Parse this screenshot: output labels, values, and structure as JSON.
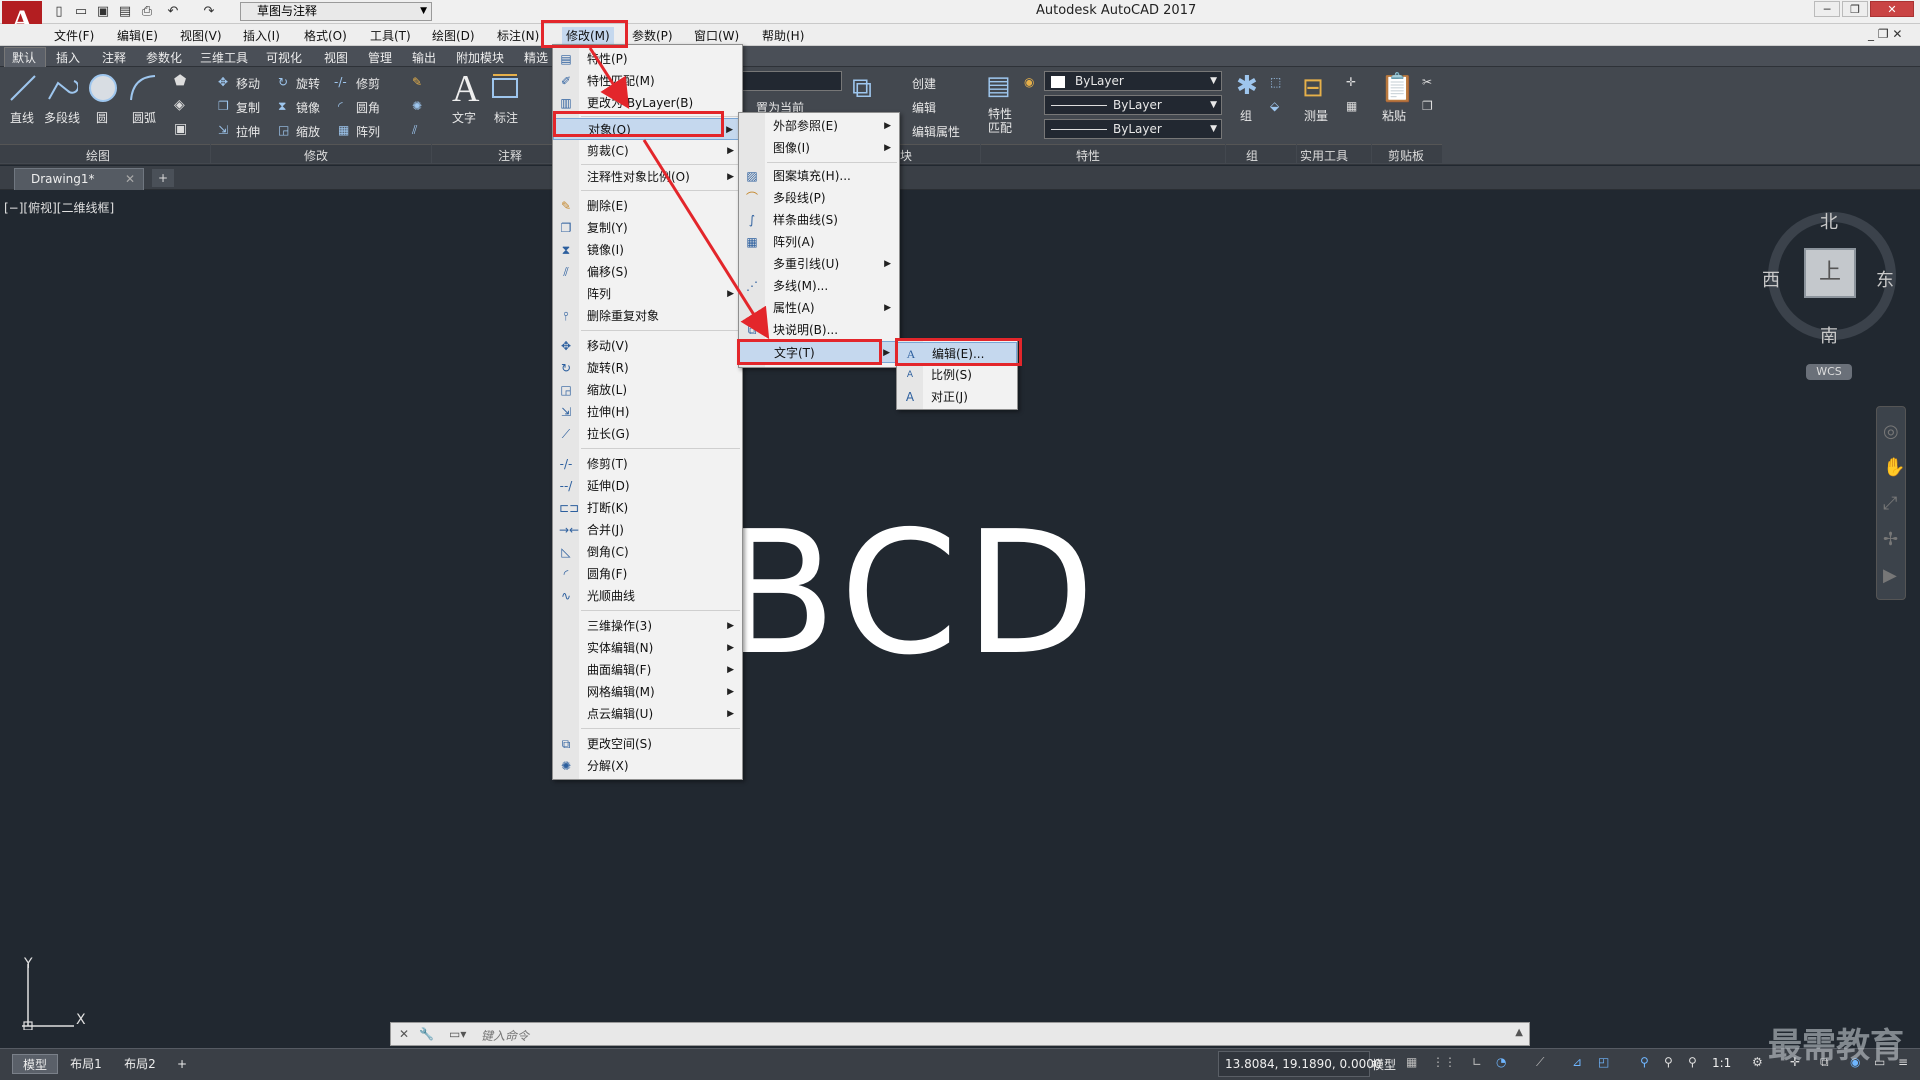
{
  "title_bar": {
    "app_title": "Autodesk AutoCAD 2017",
    "logo": "A",
    "workspace": "草图与注释"
  },
  "menu_bar": [
    "文件(F)",
    "编辑(E)",
    "视图(V)",
    "插入(I)",
    "格式(O)",
    "工具(T)",
    "绘图(D)",
    "标注(N)",
    "修改(M)",
    "参数(P)",
    "窗口(W)",
    "帮助(H)"
  ],
  "ribbon_tabs": [
    "默认",
    "插入",
    "注释",
    "参数化",
    "三维工具",
    "可视化",
    "视图",
    "管理",
    "输出",
    "附加模块",
    "精选"
  ],
  "ribbon": {
    "draw_tools": [
      "直线",
      "多段线",
      "圆",
      "圆弧"
    ],
    "modify_tools": [
      "移动",
      "旋转",
      "修剪",
      "复制",
      "镜像",
      "圆角",
      "拉伸",
      "缩放",
      "阵列"
    ],
    "annotation_tools": [
      "文字",
      "标注"
    ],
    "block_tools": [
      "创建",
      "编辑",
      "编辑属性",
      "置为当前"
    ],
    "properties": {
      "match_label": "特性匹配",
      "layer1": "ByLayer",
      "layer2": "ByLayer",
      "layer3": "ByLayer"
    },
    "group_label": "组",
    "measure_label": "测量",
    "paste_label": "粘贴",
    "panels": [
      "绘图",
      "修改",
      "注释",
      "块",
      "特性",
      "组",
      "实用工具",
      "剪贴板"
    ]
  },
  "doc_tab": "Drawing1*",
  "view_label": "[−][俯视][二维线框]",
  "canvas_text": "BCD",
  "viewcube": {
    "north": "北",
    "south": "南",
    "east": "东",
    "west": "西",
    "top": "上",
    "wcs": "WCS"
  },
  "ucs": {
    "x": "X",
    "y": "Y"
  },
  "command_placeholder": "键入命令",
  "status": {
    "tabs": [
      "模型",
      "布局1",
      "布局2"
    ],
    "coords": "13.8084, 19.1890, 0.0000",
    "mode": "模型",
    "scale": "1:1"
  },
  "watermark": "最需教育",
  "modify_menu": [
    {
      "label": "特性(P)",
      "icon": "properties-icon"
    },
    {
      "label": "特性匹配(M)",
      "icon": "match-icon"
    },
    {
      "label": "更改为 ByLayer(B)",
      "icon": "bylayer-icon"
    },
    {
      "label": "对象(O)",
      "sub": true,
      "highlight": true
    },
    {
      "label": "剪裁(C)",
      "sub": true
    },
    {
      "label": "注释性对象比例(O)",
      "sub": true
    },
    {
      "label": "删除(E)",
      "icon": "erase-icon"
    },
    {
      "label": "复制(Y)",
      "icon": "copy-icon"
    },
    {
      "label": "镜像(I)",
      "icon": "mirror-icon"
    },
    {
      "label": "偏移(S)",
      "icon": "offset-icon"
    },
    {
      "label": "阵列",
      "sub": true
    },
    {
      "label": "删除重复对象",
      "icon": "overkill-icon"
    },
    {
      "label": "移动(V)",
      "icon": "move-icon"
    },
    {
      "label": "旋转(R)",
      "icon": "rotate-icon"
    },
    {
      "label": "缩放(L)",
      "icon": "scale-icon"
    },
    {
      "label": "拉伸(H)",
      "icon": "stretch-icon"
    },
    {
      "label": "拉长(G)",
      "icon": "lengthen-icon"
    },
    {
      "label": "修剪(T)",
      "icon": "trim-icon"
    },
    {
      "label": "延伸(D)",
      "icon": "extend-icon"
    },
    {
      "label": "打断(K)",
      "icon": "break-icon"
    },
    {
      "label": "合并(J)",
      "icon": "join-icon"
    },
    {
      "label": "倒角(C)",
      "icon": "chamfer-icon"
    },
    {
      "label": "圆角(F)",
      "icon": "fillet-icon"
    },
    {
      "label": "光顺曲线",
      "icon": "blend-icon"
    },
    {
      "label": "三维操作(3)",
      "sub": true
    },
    {
      "label": "实体编辑(N)",
      "sub": true
    },
    {
      "label": "曲面编辑(F)",
      "sub": true
    },
    {
      "label": "网格编辑(M)",
      "sub": true
    },
    {
      "label": "点云编辑(U)",
      "sub": true
    },
    {
      "label": "更改空间(S)",
      "icon": "changespace-icon"
    },
    {
      "label": "分解(X)",
      "icon": "explode-icon"
    }
  ],
  "object_menu": [
    {
      "label": "外部参照(E)",
      "sub": true
    },
    {
      "label": "图像(I)",
      "sub": true
    },
    {
      "label": "图案填充(H)...",
      "icon": "hatch-icon"
    },
    {
      "label": "多段线(P)",
      "icon": "polyline-icon"
    },
    {
      "label": "样条曲线(S)",
      "icon": "spline-icon"
    },
    {
      "label": "阵列(A)",
      "icon": "array-icon"
    },
    {
      "label": "多重引线(U)",
      "sub": true
    },
    {
      "label": "多线(M)...",
      "icon": "mline-icon"
    },
    {
      "label": "属性(A)",
      "sub": true
    },
    {
      "label": "块说明(B)...",
      "icon": "block-icon"
    },
    {
      "label": "文字(T)",
      "sub": true,
      "highlight": true
    }
  ],
  "text_menu": [
    {
      "label": "编辑(E)...",
      "icon": "text-edit-icon",
      "highlight": true
    },
    {
      "label": "比例(S)",
      "icon": "text-scale-icon"
    },
    {
      "label": "对正(J)",
      "icon": "text-justify-icon"
    }
  ]
}
